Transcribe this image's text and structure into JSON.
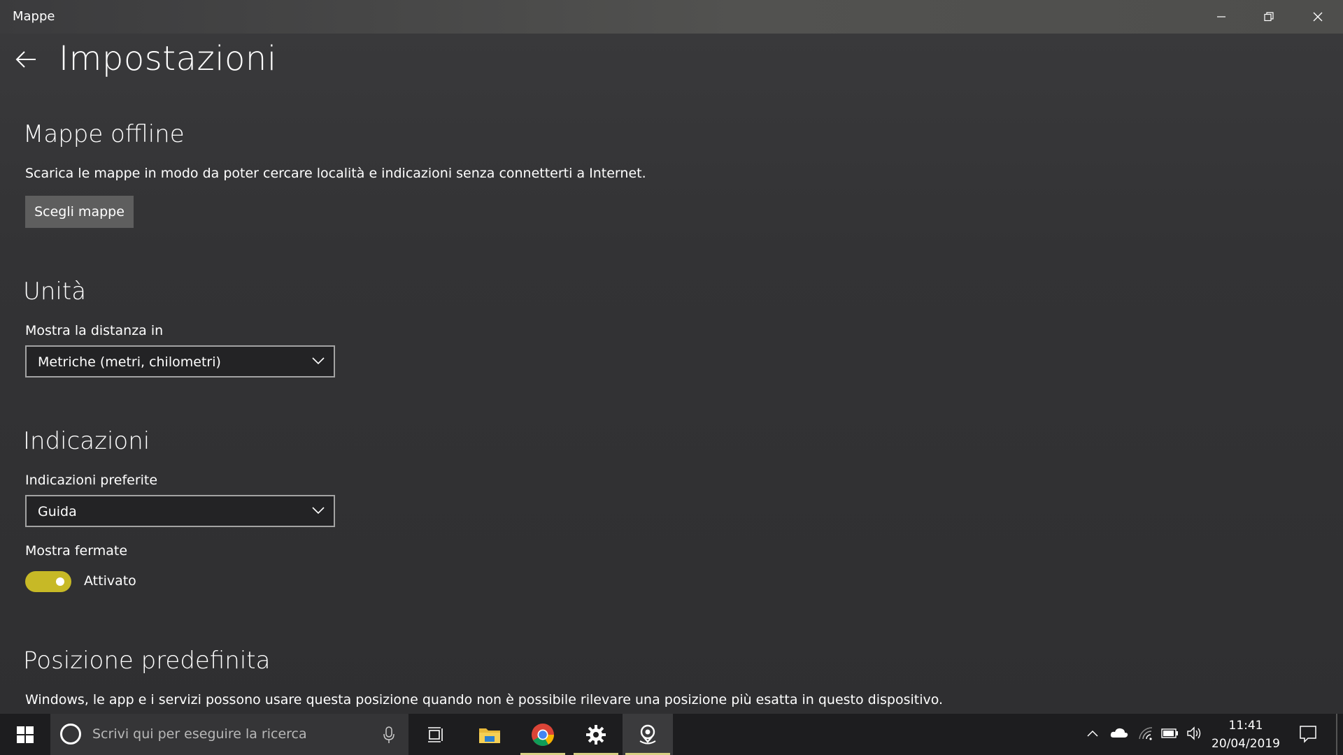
{
  "window": {
    "app_name": "Mappe",
    "controls": {
      "minimize_icon": "minimize-icon",
      "restore_icon": "restore-icon",
      "close_icon": "close-icon"
    }
  },
  "page": {
    "title": "Impostazioni",
    "back_icon": "back-arrow-icon"
  },
  "offline": {
    "title": "Mappe offline",
    "description": "Scarica le mappe in modo da poter cercare località e indicazioni senza connetterti a Internet.",
    "button_label": "Scegli mappe"
  },
  "units": {
    "title": "Unità",
    "distance_label": "Mostra la distanza in",
    "distance_value": "Metriche (metri, chilometri)"
  },
  "directions": {
    "title": "Indicazioni",
    "preferred_label": "Indicazioni preferite",
    "preferred_value": "Guida",
    "show_stops_label": "Mostra fermate",
    "show_stops_state": "Attivato",
    "show_stops_on": true
  },
  "default_location": {
    "title": "Posizione predefinita",
    "description": "Windows, le app e i servizi possono usare questa posizione quando non è possibile rilevare una posizione più esatta in questo dispositivo."
  },
  "taskbar": {
    "search_placeholder": "Scrivi qui per eseguire la ricerca",
    "apps": [
      "task-view-icon",
      "file-explorer-icon",
      "chrome-icon",
      "settings-icon",
      "maps-icon"
    ],
    "tray": [
      "chevron-up-icon",
      "onedrive-icon",
      "wifi-icon",
      "battery-icon",
      "volume-icon"
    ],
    "time": "11:41",
    "date": "20/04/2019"
  },
  "colors": {
    "accent": "#c7b926",
    "background": "#333335",
    "taskbar": "#1d1d1f"
  }
}
